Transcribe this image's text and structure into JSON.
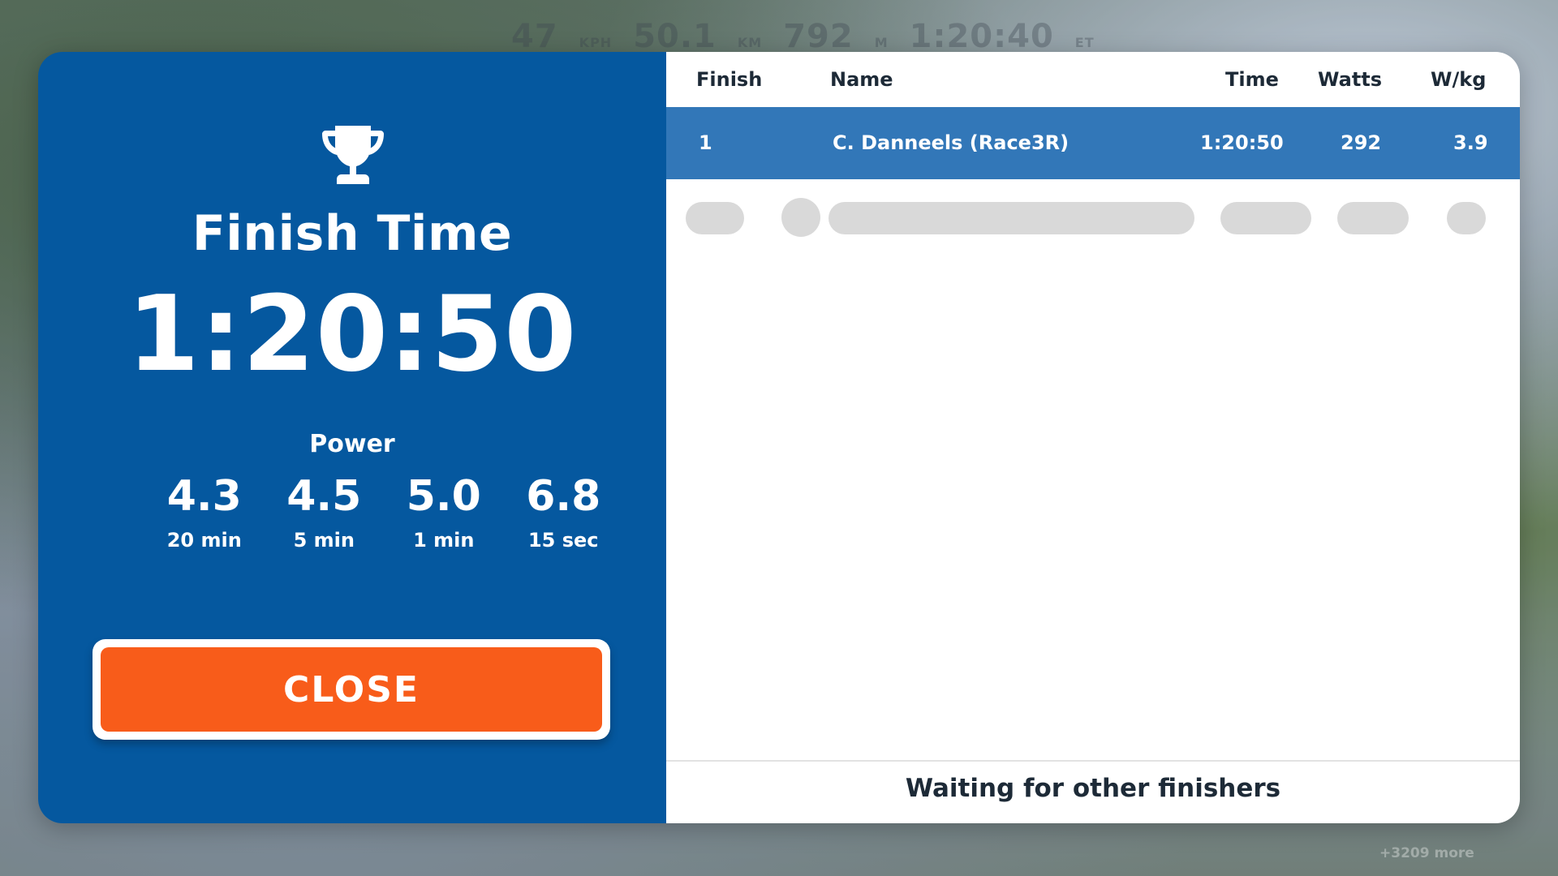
{
  "background": {
    "hud": {
      "speed": "47",
      "speed_unit": "KPH",
      "distance": "50.1",
      "distance_unit": "KM",
      "elevation": "792",
      "elevation_unit": "M",
      "elapsed": "1:20:40",
      "elapsed_unit": "ET"
    },
    "more_riders": "+3209 more"
  },
  "result_panel": {
    "icon": "trophy-icon",
    "title": "Finish Time",
    "finish_time": "1:20:50",
    "power_label": "Power",
    "power": [
      {
        "value": "4.3",
        "duration": "20 min"
      },
      {
        "value": "4.5",
        "duration": "5 min"
      },
      {
        "value": "5.0",
        "duration": "1 min"
      },
      {
        "value": "6.8",
        "duration": "15 sec"
      }
    ],
    "close_label": "CLOSE"
  },
  "results_table": {
    "columns": {
      "finish": "Finish",
      "name": "Name",
      "time": "Time",
      "watts": "Watts",
      "wkg": "W/kg"
    },
    "rows": [
      {
        "finish": "1",
        "name": "C. Danneels (Race3R)",
        "time": "1:20:50",
        "watts": "292",
        "wkg": "3.9"
      }
    ],
    "footer": "Waiting for other finishers"
  },
  "colors": {
    "panel_blue": "#05589f",
    "row_highlight": "#3277b8",
    "close_orange": "#f85c1a"
  }
}
